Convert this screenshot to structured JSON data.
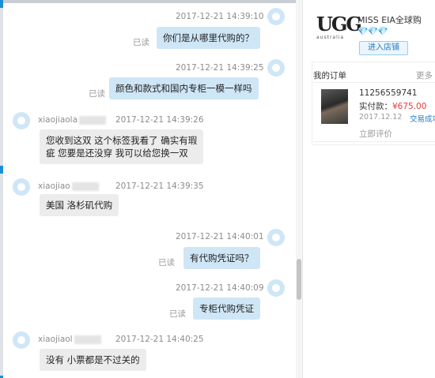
{
  "messages": [
    {
      "side": "right",
      "timestamp": "2017-12-21 14:39:10",
      "text": "你们是从哪里代购的？",
      "read": "已读"
    },
    {
      "side": "right",
      "timestamp": "2017-12-21 14:39:25",
      "text": "颜色和款式和国内专柜一模一样吗",
      "read": "已读"
    },
    {
      "side": "left",
      "sender": "xiaojiaola",
      "timestamp": "2017-12-21 14:39:26",
      "lines": [
        "您收到这双 这个标签我看了 确实有瑕",
        "疵 您要是还没穿 我可以给您换一双"
      ]
    },
    {
      "side": "left",
      "sender": "xiaojiao",
      "timestamp": "2017-12-21 14:39:35",
      "text": "美国 洛杉矶代购"
    },
    {
      "side": "right",
      "timestamp": "2017-12-21 14:40:01",
      "text": "有代购凭证吗？",
      "read": "已读"
    },
    {
      "side": "right",
      "timestamp": "2017-12-21 14:40:09",
      "text": "专柜代购凭证",
      "read": "已读"
    },
    {
      "side": "left",
      "sender": "xiaojiaol",
      "timestamp": "2017-12-21 14:40:25",
      "text": "没有  小票都是不过关的"
    }
  ],
  "shop": {
    "logo_text": "UGG",
    "logo_sub": "australia",
    "name": "MISS EIA全球购",
    "rank_icons": "💎💎💎",
    "enter_button": "进入店铺"
  },
  "orders": {
    "title": "我的订单",
    "more": "更多",
    "item": {
      "order_no": "11256559741",
      "paid_label": "实付款：",
      "paid_amount": "¥675.00",
      "date": "2017.12.12",
      "status": "交易成功"
    },
    "review_link": "立即评价"
  }
}
